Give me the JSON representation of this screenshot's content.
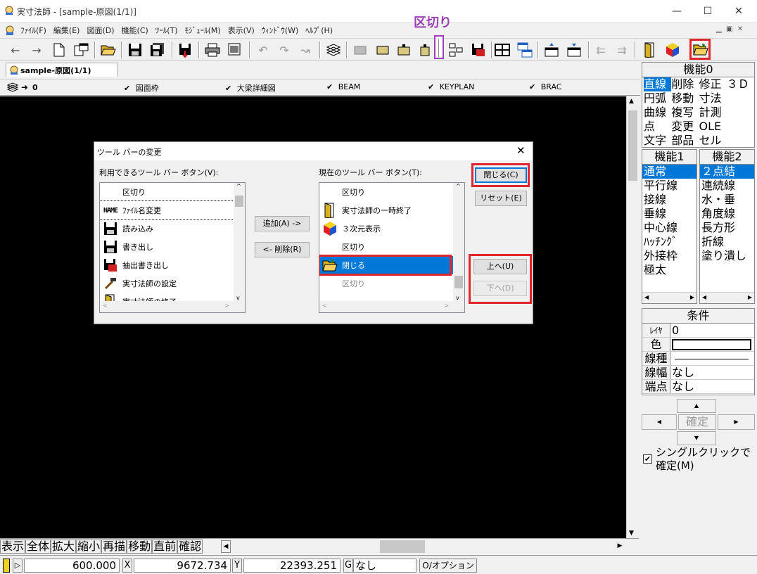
{
  "window": {
    "title": "実寸法師 - [sample-原図(1/1)]",
    "minimize": "—",
    "maximize": "☐",
    "close": "✕"
  },
  "menu": [
    "ﾌｧｲﾙ(F)",
    "編集(E)",
    "図面(D)",
    "機能(C)",
    "ﾂｰﾙ(T)",
    "ﾓｼﾞｭｰﾙ(M)",
    "表示(V)",
    "ｳｨﾝﾄﾞｳ(W)",
    "ﾍﾙﾌﾟ(H)"
  ],
  "annotation": {
    "separator_label": "区切り",
    "color": "#9b3fb5",
    "highlight_color": "#e0252c"
  },
  "tab": {
    "label": "sample-原図(1/1)"
  },
  "layers": {
    "current": "0",
    "items": [
      "図面枠",
      "大梁詳細図",
      "BEAM",
      "KEYPLAN",
      "BRAC"
    ]
  },
  "dialog": {
    "title": "ツール バーの変更",
    "available_label": "利用できるツール バー ボタン(V):",
    "current_label": "現在のツール バー ボタン(T):",
    "available_items": [
      {
        "label": "区切り",
        "icon": "none"
      },
      {
        "label": "ﾌｧｲﾙ名変更",
        "icon": "NAME"
      },
      {
        "label": "読み込み",
        "icon": "floppy"
      },
      {
        "label": "書き出し",
        "icon": "floppy"
      },
      {
        "label": "抽出書き出し",
        "icon": "floppy-red"
      },
      {
        "label": "実寸法師の設定",
        "icon": "tools"
      },
      {
        "label": "実寸法師の終了",
        "icon": "door"
      }
    ],
    "current_items": [
      {
        "label": "区切り",
        "icon": "none"
      },
      {
        "label": "実寸法師の一時終了",
        "icon": "door"
      },
      {
        "label": "３次元表示",
        "icon": "cube"
      },
      {
        "label": "区切り",
        "icon": "none"
      },
      {
        "label": "閉じる",
        "icon": "folder",
        "selected": true
      },
      {
        "label": "区切り",
        "icon": "none"
      }
    ],
    "buttons": {
      "add": "追加(A) ->",
      "remove": "<- 削除(R)",
      "close": "閉じる(C)",
      "reset": "リセット(E)",
      "up": "上へ(U)",
      "down": "下へ(D)"
    },
    "close_x": "✕"
  },
  "panel": {
    "func0": {
      "title": "機能0",
      "rows": [
        [
          "直線",
          "削除",
          "修正",
          "３Ｄ"
        ],
        [
          "円弧",
          "移動",
          "寸法",
          ""
        ],
        [
          "曲線",
          "複写",
          "計測",
          ""
        ],
        [
          "点",
          "変更",
          "OLE",
          ""
        ],
        [
          "文字",
          "部品",
          "セル",
          ""
        ]
      ]
    },
    "func1": {
      "title": "機能1",
      "items": [
        "通常",
        "平行線",
        "接線",
        "垂線",
        "中心線",
        "ﾊｯﾁﾝｸﾞ",
        "外接枠",
        "極太"
      ]
    },
    "func2": {
      "title": "機能2",
      "items": [
        "２点結",
        "連続線",
        "水・垂",
        "角度線",
        "長方形",
        "折線",
        "塗り潰し"
      ]
    },
    "conditions": {
      "title": "条件",
      "rows": [
        {
          "label": "ﾚｲﾔ",
          "value": "0"
        },
        {
          "label": "色",
          "value": ""
        },
        {
          "label": "線種",
          "value": ""
        },
        {
          "label": "線幅",
          "value": "なし"
        },
        {
          "label": "端点",
          "value": "なし"
        }
      ]
    },
    "confirm": "確定",
    "single_click": "シングルクリックで確定(M)"
  },
  "bottom_buttons": [
    "表示",
    "全体",
    "拡大",
    "縮小",
    "再描",
    "移動",
    "直前",
    "確認"
  ],
  "status": {
    "value1": "600.000",
    "x_label": "X",
    "x_value": "9672.734",
    "y_label": "Y",
    "y_value": "22393.251",
    "g_label": "G",
    "g_value": "なし",
    "option": "O/オプション"
  }
}
